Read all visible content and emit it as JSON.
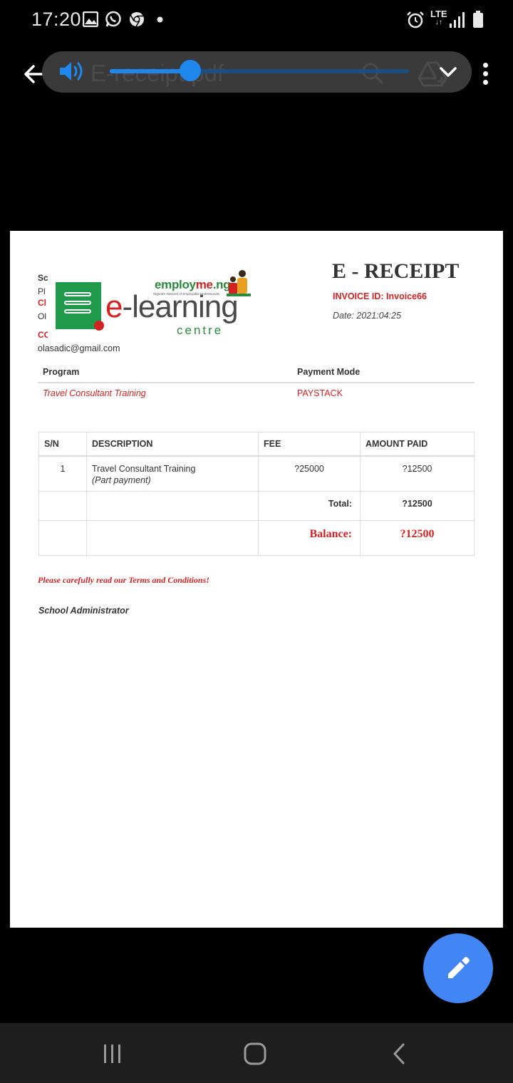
{
  "status_bar": {
    "time": "17:20",
    "network": "LTE",
    "icons": [
      "gallery-icon",
      "whatsapp-icon",
      "chrome-icon",
      "notification-dot",
      "alarm-icon",
      "signal-icon",
      "battery-icon"
    ]
  },
  "toolbar": {
    "file_name": "E-receipt.pdf",
    "volume_level": 0.27,
    "accent_color": "#1f86ee"
  },
  "document": {
    "title": "E - RECEIPT",
    "invoice_id": "INVOICE ID: Invoice66",
    "date": "Date: 2021:04:25",
    "left_fragments": [
      "Sc",
      "Pl",
      "Cl",
      "Ol",
      "CC"
    ],
    "email": "olasadic@gmail.com",
    "logo": {
      "brand_top": "employ",
      "brand_me": "me",
      "brand_tld": ".ng",
      "tagline": "Nigeria's Network of Employable Professionals",
      "brand_main_e": "e",
      "brand_main_rest": "-learning",
      "brand_sub": "centre"
    },
    "program_table": {
      "headers": [
        "Program",
        "Payment Mode"
      ],
      "row": [
        "Travel Consultant Training",
        "PAYSTACK"
      ]
    },
    "fee_table": {
      "headers": [
        "S/N",
        "DESCRIPTION",
        "FEE",
        "AMOUNT PAID"
      ],
      "item": {
        "sn": "1",
        "description": "Travel Consultant Training",
        "note": "(Part payment)",
        "fee": "?25000",
        "amount_paid": "?12500"
      },
      "total_label": "Total:",
      "total_value": "?12500",
      "balance_label": "Balance:",
      "balance_value": "?12500"
    },
    "terms": "Please carefully read our Terms and Conditions!",
    "signature": "School Administrator"
  },
  "fab": {
    "icon": "pencil-icon",
    "color": "#4285f4"
  },
  "nav_bar": {
    "buttons": [
      "recents-icon",
      "home-icon",
      "back-icon"
    ]
  }
}
